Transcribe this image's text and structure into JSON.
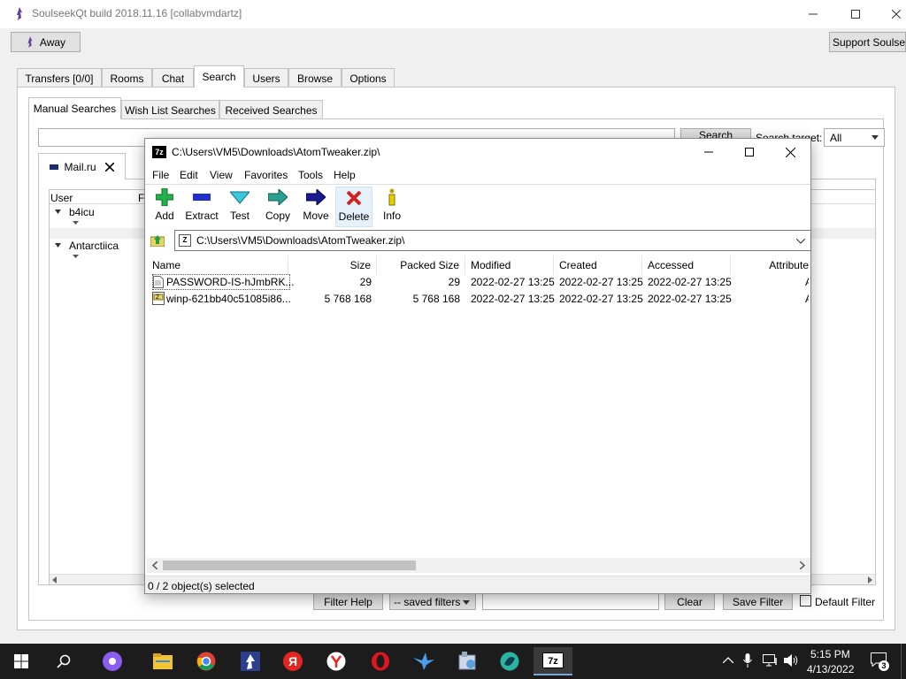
{
  "soulseek": {
    "title": "SoulseekQt build 2018.11.16 [collabvmdartz]",
    "away_label": "Away",
    "support_label": "Support Soulseek",
    "main_tabs": [
      {
        "label": "Transfers [0/0]"
      },
      {
        "label": "Rooms"
      },
      {
        "label": "Chat"
      },
      {
        "label": "Search"
      },
      {
        "label": "Users"
      },
      {
        "label": "Browse"
      },
      {
        "label": "Options"
      }
    ],
    "sub_tabs": [
      {
        "label": "Manual Searches"
      },
      {
        "label": "Wish List Searches"
      },
      {
        "label": "Received Searches"
      }
    ],
    "search_button": "Search",
    "search_target_label": "Search target:",
    "search_target_value": "All",
    "result_tab": "Mail.ru",
    "col_user": "User",
    "col_file": "Fi",
    "users": [
      "b4icu",
      "Antarctiica"
    ],
    "filter_help": "Filter Help",
    "saved_filters": "-- saved filters",
    "clear": "Clear",
    "save_filter": "Save Filter",
    "default_filter": "Default Filter"
  },
  "sevenzip": {
    "title": "C:\\Users\\VM5\\Downloads\\AtomTweaker.zip\\",
    "menu": [
      "File",
      "Edit",
      "View",
      "Favorites",
      "Tools",
      "Help"
    ],
    "tools": [
      "Add",
      "Extract",
      "Test",
      "Copy",
      "Move",
      "Delete",
      "Info"
    ],
    "address": "C:\\Users\\VM5\\Downloads\\AtomTweaker.zip\\",
    "columns": [
      "Name",
      "Size",
      "Packed Size",
      "Modified",
      "Created",
      "Accessed",
      "Attribute"
    ],
    "rows": [
      {
        "name": "PASSWORD-IS-hJmbRK...",
        "size": "29",
        "packed": "29",
        "modified": "2022-02-27 13:25",
        "created": "2022-02-27 13:25",
        "accessed": "2022-02-27 13:25",
        "attr": "A"
      },
      {
        "name": "winp-621bb40c51085i86...",
        "size": "5 768 168",
        "packed": "5 768 168",
        "modified": "2022-02-27 13:25",
        "created": "2022-02-27 13:25",
        "accessed": "2022-02-27 13:25",
        "attr": "A"
      }
    ],
    "status": "0 / 2 object(s) selected"
  },
  "taskbar": {
    "time": "5:15 PM",
    "date": "4/13/2022",
    "notif_count": "3",
    "yandex_label": "Я",
    "sevenzip_label": "7z"
  },
  "colors": {
    "accent": "#0078d7",
    "taskbar": "#1c1c1c",
    "add_green": "#22b14c",
    "delete_red": "#d42020"
  }
}
